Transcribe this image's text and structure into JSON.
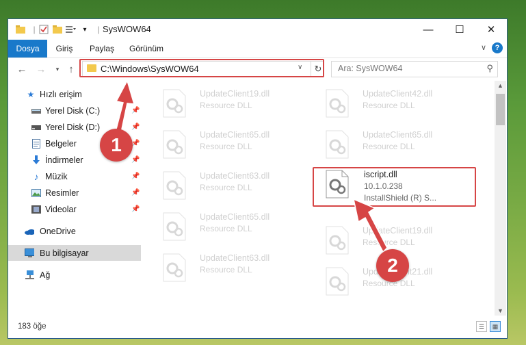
{
  "window": {
    "title": "SysWOW64",
    "controls": {
      "minimize": "—",
      "maximize": "☐",
      "close": "✕"
    }
  },
  "ribbon": {
    "tabs": [
      "Dosya",
      "Giriş",
      "Paylaş",
      "Görünüm"
    ],
    "help_label": "?"
  },
  "address": {
    "path": "C:\\Windows\\SysWOW64",
    "search_placeholder": "Ara: SysWOW64"
  },
  "nav": {
    "quick_access": "Hızlı erişim",
    "items": [
      {
        "label": "Yerel Disk (C:)",
        "icon": "drive-icon",
        "pinned": true
      },
      {
        "label": "Yerel Disk (D:)",
        "icon": "drive-icon",
        "pinned": true
      },
      {
        "label": "Belgeler",
        "icon": "documents-icon",
        "pinned": true
      },
      {
        "label": "İndirmeler",
        "icon": "downloads-icon",
        "pinned": true
      },
      {
        "label": "Müzik",
        "icon": "music-icon",
        "pinned": true
      },
      {
        "label": "Resimler",
        "icon": "pictures-icon",
        "pinned": true
      },
      {
        "label": "Videolar",
        "icon": "videos-icon",
        "pinned": true
      }
    ],
    "onedrive": "OneDrive",
    "this_pc": "Bu bilgisayar",
    "network": "Ağ"
  },
  "files": {
    "col1": [
      {
        "name": "UpdateClient19.dll",
        "sub": "Resource DLL"
      },
      {
        "name": "UpdateClient65.dll",
        "sub": "Resource DLL"
      },
      {
        "name": "UpdateClient63.dll",
        "sub": "Resource DLL"
      },
      {
        "name": "UpdateClient65.dll",
        "sub": "Resource DLL"
      },
      {
        "name": "UpdateClient63.dll",
        "sub": "Resource DLL"
      }
    ],
    "col2": [
      {
        "name": "UpdateClient42.dll",
        "sub": "Resource DLL"
      },
      {
        "name": "UpdateClient65.dll",
        "sub": "Resource DLL"
      },
      {
        "name": "iscript.dll",
        "sub": "10.1.0.238",
        "sub2": "InstallShield (R) S..."
      },
      {
        "name": "UpdateClient19.dll",
        "sub": "Resource DLL"
      },
      {
        "name": "UpdateClient21.dll",
        "sub": "Resource DLL"
      }
    ]
  },
  "status": {
    "count": "183 öğe"
  },
  "callouts": {
    "one": "1",
    "two": "2"
  },
  "colors": {
    "accent": "#1979ca",
    "callout": "#d64545",
    "folder": "#f3c94d"
  }
}
